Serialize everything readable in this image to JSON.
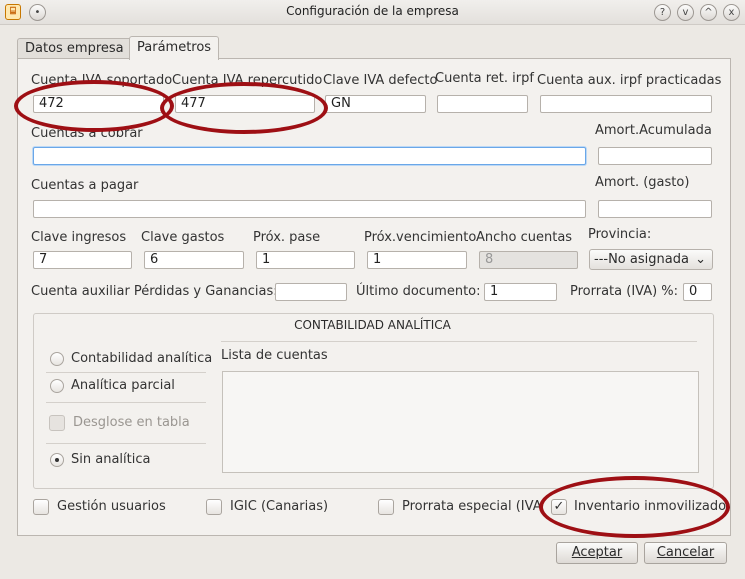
{
  "window": {
    "title": "Configuración de la empresa",
    "controls": [
      "?",
      "v",
      "^",
      "x"
    ]
  },
  "tabs": [
    {
      "label": "Datos empresa"
    },
    {
      "label": "Parámetros"
    }
  ],
  "fields": {
    "cuenta_iva_soportado": {
      "label": "Cuenta IVA soportado",
      "value": "472"
    },
    "cuenta_iva_repercutido": {
      "label": "Cuenta IVA repercutido",
      "value": "477"
    },
    "clave_iva_defecto": {
      "label": "Clave IVA defecto",
      "value": "GN"
    },
    "cuenta_ret_irpf": {
      "label": "Cuenta ret. irpf",
      "value": ""
    },
    "cuenta_aux_irpf": {
      "label": "Cuenta aux. irpf practicadas",
      "value": ""
    },
    "cuentas_cobrar": {
      "label": "Cuentas a cobrar",
      "value": ""
    },
    "amort_acumulada": {
      "label": "Amort.Acumulada",
      "value": ""
    },
    "cuentas_pagar": {
      "label": "Cuentas a pagar",
      "value": ""
    },
    "amort_gasto": {
      "label": "Amort. (gasto)",
      "value": ""
    },
    "clave_ingresos": {
      "label": "Clave ingresos",
      "value": "7"
    },
    "clave_gastos": {
      "label": "Clave gastos",
      "value": "6"
    },
    "prox_pase": {
      "label": "Próx. pase",
      "value": "1"
    },
    "prox_vencimiento": {
      "label": "Próx.vencimiento",
      "value": "1"
    },
    "ancho_cuentas": {
      "label": "Ancho cuentas",
      "value": "8"
    },
    "provincia": {
      "label": "Provincia:",
      "value": "---No asignada"
    },
    "cuenta_pyg": {
      "label": "Cuenta auxiliar Pérdidas y Ganancias:",
      "value": ""
    },
    "ultimo_documento": {
      "label": "Último documento:",
      "value": "1"
    },
    "prorrata": {
      "label": "Prorrata (IVA) %:",
      "value": "0"
    }
  },
  "analitica": {
    "title": "CONTABILIDAD ANALÍTICA",
    "options": [
      "Contabilidad analítica",
      "Analítica parcial",
      "Desglose en tabla",
      "Sin analítica"
    ],
    "list_label": "Lista de cuentas"
  },
  "checks": {
    "gestion_usuarios": {
      "label": "Gestión usuarios",
      "checked": false
    },
    "igic": {
      "label": "IGIC (Canarias)",
      "checked": false
    },
    "prorrata_especial": {
      "label": "Prorrata especial (IVA",
      "checked": false
    },
    "inventario": {
      "label": "Inventario inmovilizado",
      "checked": true,
      "mark": "✓"
    }
  },
  "buttons": {
    "accept": "Aceptar",
    "cancel": "Cancelar"
  },
  "colors": {
    "annotation": "#9e0f14",
    "focus": "#6aa7e8"
  }
}
